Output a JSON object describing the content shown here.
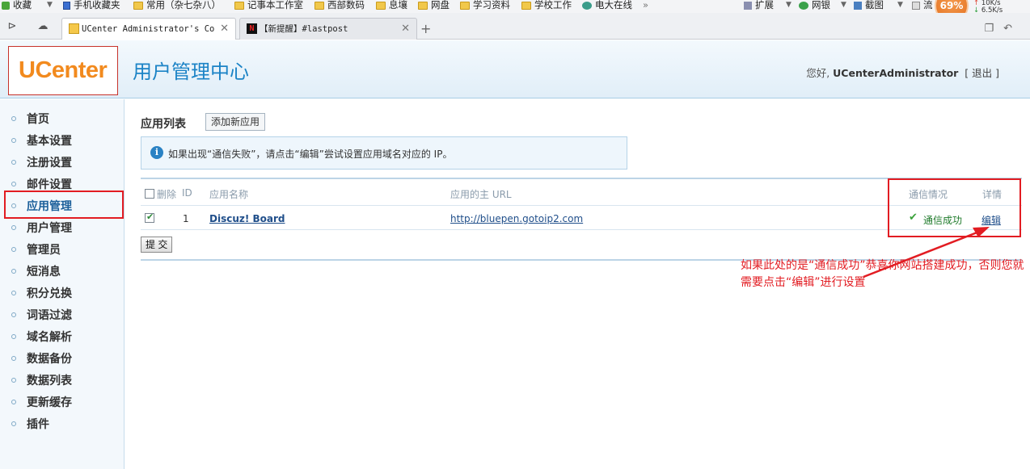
{
  "bookmarks": [
    {
      "label": "收藏",
      "icon": "add-favorite-icon"
    },
    {
      "label": "手机收藏夹",
      "icon": "phone-icon"
    },
    {
      "label": "常用（杂七杂八）",
      "icon": "folder-icon"
    },
    {
      "label": "记事本工作室",
      "icon": "folder-icon"
    },
    {
      "label": "西部数码",
      "icon": "folder-icon"
    },
    {
      "label": "息壤",
      "icon": "folder-icon"
    },
    {
      "label": "网盘",
      "icon": "folder-icon"
    },
    {
      "label": "学习资料",
      "icon": "folder-icon"
    },
    {
      "label": "学校工作",
      "icon": "folder-icon"
    },
    {
      "label": "电大在线",
      "icon": "globe-icon"
    }
  ],
  "toolbar_right": {
    "extensions": "扩展",
    "netbank": "网银",
    "screenshot": "截图",
    "traffic": "流",
    "battery": "69%",
    "speed_up": "10K/s",
    "speed_down": "6.5K/s"
  },
  "tabs": [
    {
      "title": "UCenter Administrator's Co",
      "active": true
    },
    {
      "title": "【新提醒】#lastpost",
      "active": false
    }
  ],
  "header": {
    "logo": "UCenter",
    "title": "用户管理中心",
    "greeting": "您好,",
    "username": "UCenterAdministrator",
    "logout": "[ 退出 ]"
  },
  "sidebar": {
    "items": [
      {
        "label": "首页"
      },
      {
        "label": "基本设置"
      },
      {
        "label": "注册设置"
      },
      {
        "label": "邮件设置"
      },
      {
        "label": "应用管理",
        "active": true
      },
      {
        "label": "用户管理"
      },
      {
        "label": "管理员"
      },
      {
        "label": "短消息"
      },
      {
        "label": "积分兑换"
      },
      {
        "label": "词语过滤"
      },
      {
        "label": "域名解析"
      },
      {
        "label": "数据备份"
      },
      {
        "label": "数据列表"
      },
      {
        "label": "更新缓存"
      },
      {
        "label": "插件"
      }
    ]
  },
  "main": {
    "section_title": "应用列表",
    "add_button": "添加新应用",
    "notice": "如果出现“通信失败”，请点击“编辑”尝试设置应用域名对应的 IP。",
    "table": {
      "headers": {
        "delete": "删除",
        "id": "ID",
        "name": "应用名称",
        "url": "应用的主 URL",
        "status": "通信情况",
        "detail": "详情"
      },
      "rows": [
        {
          "checked": true,
          "id": "1",
          "name": "Discuz! Board",
          "url": "http://bluepen.gotoip2.com",
          "status": "通信成功",
          "action": "编辑"
        }
      ]
    },
    "submit": "提 交"
  },
  "annotation": {
    "text": "如果此处的是“通信成功”恭喜你网站搭建成功，否则您就需要点击“编辑”进行设置",
    "color": "#e21c22"
  }
}
